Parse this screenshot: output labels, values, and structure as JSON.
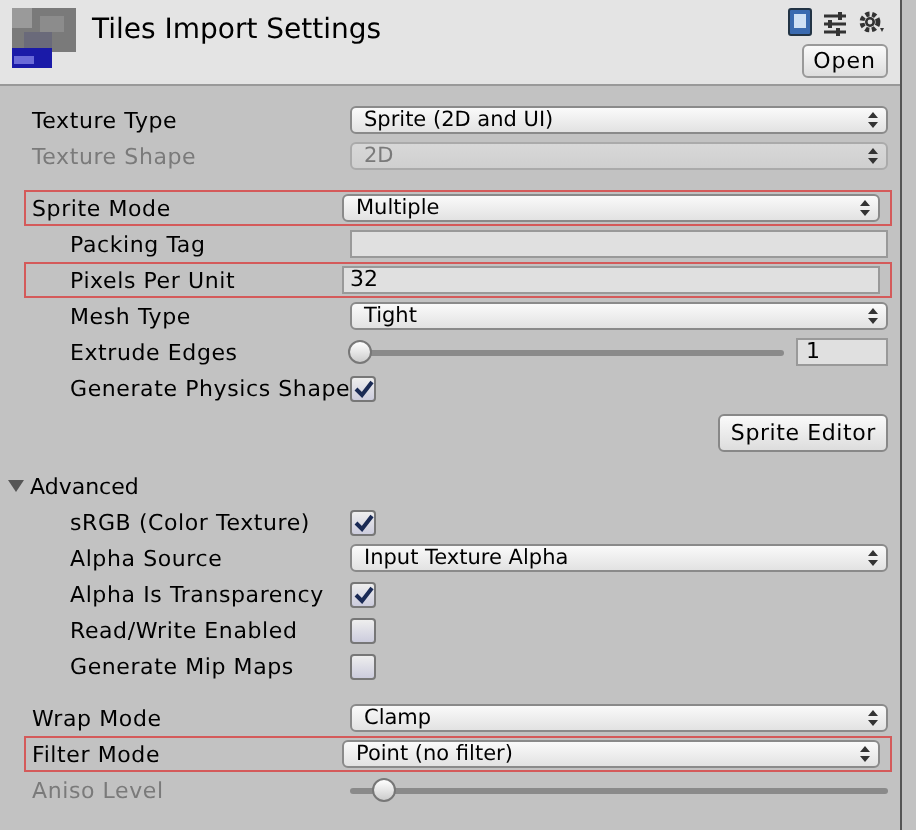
{
  "header": {
    "title": "Tiles Import Settings",
    "open_button": "Open"
  },
  "sections": [
    {
      "rows": [
        {
          "kind": "dropdown",
          "label": "Texture Type",
          "value": "Sprite (2D and UI)",
          "disabled": false,
          "highlighted": false
        },
        {
          "kind": "dropdown",
          "label": "Texture Shape",
          "value": "2D",
          "disabled": true,
          "highlighted": false
        }
      ]
    },
    {
      "rows": [
        {
          "kind": "dropdown",
          "label": "Sprite Mode",
          "value": "Multiple",
          "disabled": false,
          "highlighted": true,
          "children": [
            {
              "kind": "text",
              "label": "Packing Tag",
              "disabled": false,
              "highlighted": false
            },
            {
              "kind": "text",
              "label": "Pixels Per Unit",
              "value": "32",
              "disabled": false,
              "highlighted": true
            },
            {
              "kind": "dropdown",
              "label": "Mesh Type",
              "value": "Tight",
              "disabled": false,
              "highlighted": false
            },
            {
              "kind": "slider",
              "label": "Extrude Edges",
              "level": 0.02,
              "value": "1",
              "disabled": false,
              "highlighted": false
            },
            {
              "kind": "checkbox",
              "label": "Generate Physics Shape",
              "checked": true,
              "disabled": false,
              "highlighted": false
            }
          ]
        },
        {
          "kind": "button",
          "label": "Sprite Editor"
        }
      ]
    },
    {
      "rows": [
        {
          "kind": "foldout",
          "label": "Advanced",
          "expanded": true,
          "children": [
            {
              "kind": "checkbox",
              "label": "sRGB (Color Texture)",
              "checked": true,
              "disabled": false,
              "highlighted": false
            },
            {
              "kind": "dropdown",
              "label": "Alpha Source",
              "value": "Input Texture Alpha",
              "disabled": false,
              "highlighted": false
            },
            {
              "kind": "checkbox",
              "label": "Alpha Is Transparency",
              "checked": true,
              "disabled": false,
              "highlighted": false
            },
            {
              "kind": "checkbox",
              "label": "Read/Write Enabled",
              "checked": false,
              "disabled": false,
              "highlighted": false
            },
            {
              "kind": "checkbox",
              "label": "Generate Mip Maps",
              "checked": false,
              "disabled": false,
              "highlighted": false
            }
          ]
        }
      ]
    },
    {
      "rows": [
        {
          "kind": "dropdown",
          "label": "Wrap Mode",
          "value": "Clamp",
          "disabled": false,
          "highlighted": false
        },
        {
          "kind": "dropdown",
          "label": "Filter Mode",
          "value": "Point (no filter)",
          "disabled": false,
          "highlighted": true
        },
        {
          "kind": "slider",
          "label": "Aniso Level",
          "level": 0.06,
          "disabled": true,
          "highlighted": false
        }
      ]
    }
  ]
}
